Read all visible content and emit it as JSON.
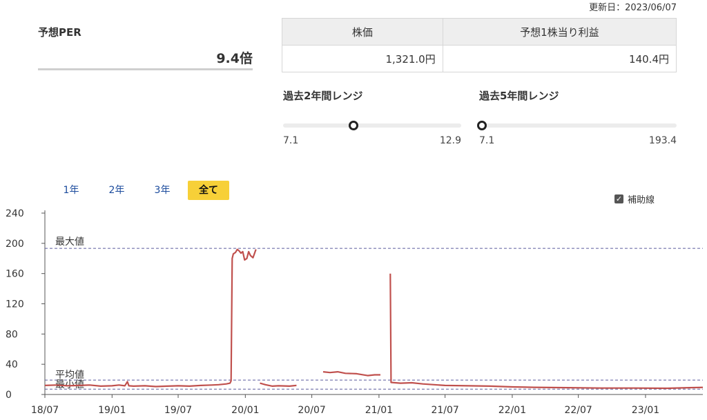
{
  "updated": "更新日：2023/06/07",
  "per": {
    "label": "予想PER",
    "value": "9.4倍"
  },
  "kpi": {
    "price_label": "株価",
    "eps_label": "予想1株当り利益",
    "price_value": "1,321.0円",
    "eps_value": "140.4円"
  },
  "range2": {
    "title": "過去2年間レンジ",
    "min": "7.1",
    "max": "12.9",
    "current": 9.4
  },
  "range5": {
    "title": "過去5年間レンジ",
    "min": "7.1",
    "max": "193.4",
    "current": 9.4
  },
  "tabs": [
    "1年",
    "2年",
    "3年",
    "全て"
  ],
  "active_tab": "全て",
  "aux_label": "補助線",
  "colors": {
    "line": "#c0504d",
    "ref": "#5a5a9c",
    "tab_active": "#f7d038",
    "link": "#1a4a9c"
  },
  "chart_data": {
    "type": "line",
    "title": "",
    "xlabel": "",
    "ylabel": "",
    "ylim": [
      0,
      240
    ],
    "yticks": [
      0,
      40,
      80,
      120,
      160,
      200,
      240
    ],
    "xticks": [
      "18/07",
      "19/01",
      "19/07",
      "20/01",
      "20/07",
      "21/01",
      "21/07",
      "22/01",
      "22/07",
      "23/01"
    ],
    "xlim": [
      "2018-07-01",
      "2023-06-07"
    ],
    "grid": false,
    "reference_lines": [
      {
        "label": "最大値",
        "value": 193.4
      },
      {
        "label": "平均値",
        "value": 19
      },
      {
        "label": "最小値",
        "value": 7.1
      }
    ],
    "series": [
      {
        "segments": [
          [
            [
              "2018-07-01",
              12
            ],
            [
              "2018-08-01",
              12.5
            ],
            [
              "2018-09-01",
              11.5
            ],
            [
              "2018-10-01",
              12
            ],
            [
              "2018-11-01",
              12.5
            ],
            [
              "2018-12-01",
              11
            ],
            [
              "2019-01-01",
              11.5
            ],
            [
              "2019-01-20",
              12.5
            ],
            [
              "2019-02-05",
              11.5
            ],
            [
              "2019-02-12",
              17
            ],
            [
              "2019-02-16",
              11.5
            ],
            [
              "2019-03-01",
              11
            ],
            [
              "2019-04-01",
              11.5
            ],
            [
              "2019-05-01",
              10.5
            ],
            [
              "2019-06-01",
              11
            ],
            [
              "2019-07-01",
              11.5
            ],
            [
              "2019-08-01",
              11
            ],
            [
              "2019-09-01",
              12
            ],
            [
              "2019-10-01",
              12.5
            ],
            [
              "2019-10-20",
              13
            ],
            [
              "2019-11-10",
              14
            ],
            [
              "2019-11-20",
              15
            ],
            [
              "2019-11-23",
              18
            ],
            [
              "2019-11-26",
              180
            ],
            [
              "2019-11-29",
              186
            ],
            [
              "2019-12-05",
              188
            ],
            [
              "2019-12-10",
              192
            ],
            [
              "2019-12-15",
              190
            ],
            [
              "2019-12-20",
              187
            ],
            [
              "2019-12-25",
              189
            ],
            [
              "2019-12-30",
              178
            ],
            [
              "2020-01-05",
              180
            ],
            [
              "2020-01-10",
              189
            ],
            [
              "2020-01-15",
              184
            ],
            [
              "2020-01-22",
              181
            ],
            [
              "2020-01-30",
              192
            ]
          ],
          [
            [
              "2020-02-10",
              15
            ],
            [
              "2020-02-25",
              13
            ],
            [
              "2020-03-15",
              11
            ],
            [
              "2020-04-01",
              11.5
            ],
            [
              "2020-05-01",
              11
            ],
            [
              "2020-05-20",
              12
            ]
          ],
          [
            [
              "2020-08-01",
              30
            ],
            [
              "2020-08-20",
              29
            ],
            [
              "2020-09-10",
              30
            ],
            [
              "2020-10-01",
              28
            ],
            [
              "2020-11-01",
              27.5
            ],
            [
              "2020-12-01",
              25
            ],
            [
              "2020-12-20",
              26
            ],
            [
              "2021-01-05",
              26
            ]
          ],
          [
            [
              "2021-02-01",
              160
            ],
            [
              "2021-02-03",
              16
            ],
            [
              "2021-03-01",
              15
            ],
            [
              "2021-04-01",
              15.5
            ],
            [
              "2021-05-01",
              14
            ],
            [
              "2021-06-01",
              13
            ],
            [
              "2021-07-01",
              12
            ],
            [
              "2021-09-01",
              11.5
            ],
            [
              "2021-11-01",
              11
            ],
            [
              "2022-01-01",
              10
            ],
            [
              "2022-03-01",
              9.5
            ],
            [
              "2022-06-01",
              9
            ],
            [
              "2022-09-01",
              8.5
            ],
            [
              "2022-12-01",
              8.5
            ],
            [
              "2023-03-01",
              8.2
            ],
            [
              "2023-05-01",
              9
            ],
            [
              "2023-06-07",
              9.4
            ]
          ]
        ]
      }
    ]
  }
}
